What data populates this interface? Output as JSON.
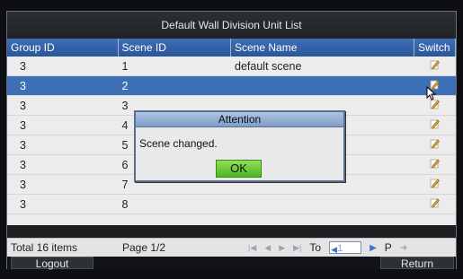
{
  "title": "Default Wall Division Unit List",
  "columns": [
    "Group ID",
    "Scene ID",
    "Scene Name",
    "Switch"
  ],
  "rows": [
    {
      "group": "3",
      "scene": "1",
      "name": "default scene"
    },
    {
      "group": "3",
      "scene": "2",
      "name": ""
    },
    {
      "group": "3",
      "scene": "3",
      "name": ""
    },
    {
      "group": "3",
      "scene": "4",
      "name": ""
    },
    {
      "group": "3",
      "scene": "5",
      "name": ""
    },
    {
      "group": "3",
      "scene": "6",
      "name": ""
    },
    {
      "group": "3",
      "scene": "7",
      "name": ""
    },
    {
      "group": "3",
      "scene": "8",
      "name": ""
    }
  ],
  "selected_row": 1,
  "footer": {
    "total": "Total 16 items",
    "page": "Page 1/2",
    "to_label": "To",
    "page_value": "1",
    "p_label": "P"
  },
  "buttons": {
    "logout": "Logout",
    "return": "Return"
  },
  "dialog": {
    "title": "Attention",
    "message": "Scene changed.",
    "ok": "OK"
  },
  "colors": {
    "header": "#3a67ad",
    "selected_row": "#3c6fb5",
    "ok_button": "#6ccb3b"
  }
}
